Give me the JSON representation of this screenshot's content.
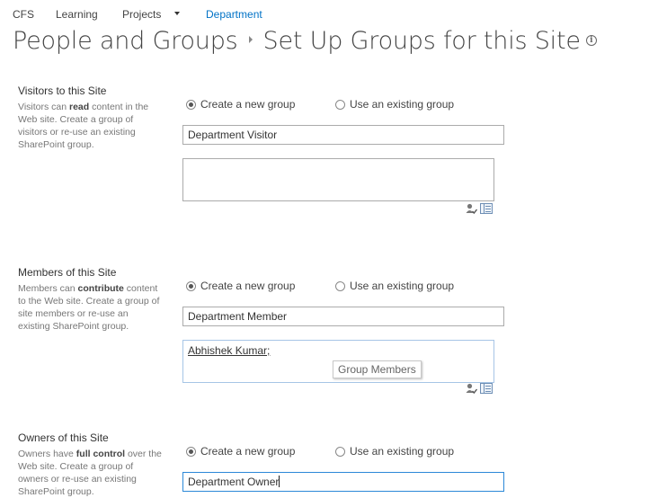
{
  "nav": {
    "items": [
      {
        "label": "CFS"
      },
      {
        "label": "Learning"
      },
      {
        "label": "Projects"
      },
      {
        "label": "Department"
      }
    ]
  },
  "title": {
    "parent": "People and Groups",
    "current": "Set Up Groups for this Site",
    "info_icon": "i"
  },
  "radio_labels": {
    "new": "Create a new group",
    "existing": "Use an existing group"
  },
  "sections": {
    "visitors": {
      "title": "Visitors to this Site",
      "desc_pre": "Visitors can ",
      "desc_bold": "read",
      "desc_post": " content in the Web site. Create a group of visitors or re-use an existing SharePoint group.",
      "selected": "new",
      "group_name": "Department Visitor",
      "people": ""
    },
    "members": {
      "title": "Members of this Site",
      "desc_pre": "Members can ",
      "desc_bold": "contribute",
      "desc_post": " content to the Web site. Create a group of site members or re-use an existing SharePoint group.",
      "selected": "new",
      "group_name": "Department Member",
      "people": "Abhishek Kumar;",
      "tooltip": "Group Members"
    },
    "owners": {
      "title": "Owners of this Site",
      "desc_pre": "Owners have ",
      "desc_bold": "full control",
      "desc_post": " over the Web site. Create a group of owners or re-use an existing SharePoint group.",
      "selected": "new",
      "group_name": "Department Owner"
    }
  },
  "colors": {
    "accent": "#0072c6",
    "focus_border": "#2b88d8"
  }
}
